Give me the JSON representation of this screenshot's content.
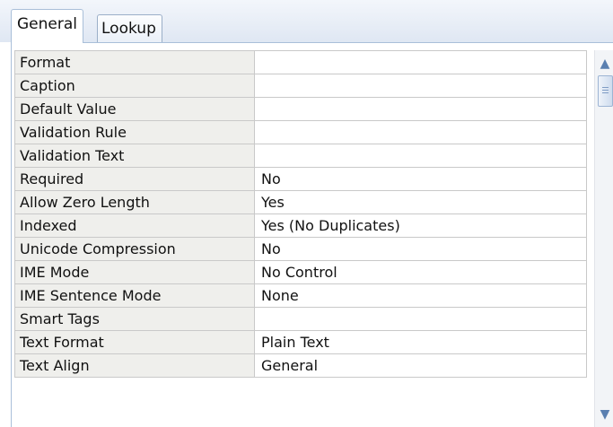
{
  "tabs": [
    {
      "label": "General",
      "selected": true
    },
    {
      "label": "Lookup",
      "selected": false
    }
  ],
  "properties": [
    {
      "name": "Format",
      "value": ""
    },
    {
      "name": "Caption",
      "value": ""
    },
    {
      "name": "Default Value",
      "value": ""
    },
    {
      "name": "Validation Rule",
      "value": ""
    },
    {
      "name": "Validation Text",
      "value": ""
    },
    {
      "name": "Required",
      "value": "No"
    },
    {
      "name": "Allow Zero Length",
      "value": "Yes"
    },
    {
      "name": "Indexed",
      "value": "Yes (No Duplicates)"
    },
    {
      "name": "Unicode Compression",
      "value": "No"
    },
    {
      "name": "IME Mode",
      "value": "No Control"
    },
    {
      "name": "IME Sentence Mode",
      "value": "None"
    },
    {
      "name": "Smart Tags",
      "value": ""
    },
    {
      "name": "Text Format",
      "value": "Plain Text"
    },
    {
      "name": "Text Align",
      "value": "General"
    }
  ],
  "scrollbar": {
    "up_icon": "chevron-up-icon",
    "down_icon": "chevron-down-icon"
  },
  "colors": {
    "label_cell_bg": "#efefec",
    "grid_line": "#c9c9c9",
    "tab_border": "#a9bfd9",
    "scroll_arrow": "#5a7fb0"
  }
}
